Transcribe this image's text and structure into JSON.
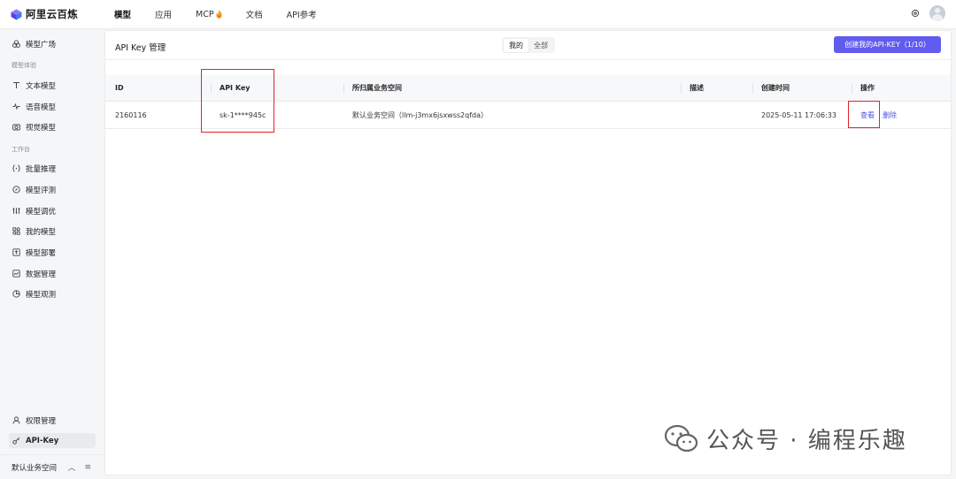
{
  "topnav": {
    "logo_text": "阿里云百炼",
    "items": [
      {
        "label": "模型",
        "active": true
      },
      {
        "label": "应用",
        "active": false
      },
      {
        "label": "MCP",
        "active": false
      },
      {
        "label": "文档",
        "active": false
      },
      {
        "label": "API参考",
        "active": false
      }
    ],
    "icons": [
      "settings-icon",
      "avatar"
    ]
  },
  "sidebar": {
    "items": [
      {
        "label": "模型广场",
        "icon": "model-square-icon"
      },
      {
        "group": "模型体验"
      },
      {
        "label": "文本模型",
        "icon": "text-icon"
      },
      {
        "label": "语音模型",
        "icon": "audio-wave-icon"
      },
      {
        "label": "视觉模型",
        "icon": "camera-icon"
      },
      {
        "group": "工作台"
      },
      {
        "label": "批量推理",
        "icon": "batch-icon"
      },
      {
        "label": "模型评测",
        "icon": "evaluate-icon"
      },
      {
        "label": "模型调优",
        "icon": "sliders-icon"
      },
      {
        "label": "我的模型",
        "icon": "my-models-icon"
      },
      {
        "label": "模型部署",
        "icon": "deploy-icon"
      },
      {
        "label": "数据管理",
        "icon": "data-icon"
      },
      {
        "label": "模型观测",
        "icon": "observe-icon"
      }
    ],
    "bottom_items": [
      {
        "label": "权限管理",
        "icon": "user-icon",
        "active": false
      },
      {
        "label": "API-Key",
        "icon": "key-icon",
        "active": true
      }
    ],
    "workspace_label": "默认业务空间"
  },
  "main": {
    "title": "API Key 管理",
    "scope_toggle": {
      "options": [
        "我的",
        "全部"
      ],
      "selected": "我的"
    },
    "create_button": "创建我的API-KEY（1/10）",
    "table": {
      "columns": [
        "ID",
        "API Key",
        "所归属业务空间",
        "描述",
        "创建时间",
        "操作"
      ],
      "rows": [
        {
          "id": "2160116",
          "api_key": "sk-1****945c",
          "workspace": "默认业务空间（llm-j3mx6jsxwss2qfda）",
          "description": "",
          "created": "2025-05-11 17:06:33",
          "actions": [
            "查看",
            "删除"
          ]
        }
      ]
    }
  },
  "watermark": {
    "text": "公众号 · 编程乐趣",
    "icon": "wechat-icon"
  },
  "colors": {
    "accent": "#615ced",
    "link": "#4b55e0",
    "highlight": "#e0242b"
  }
}
